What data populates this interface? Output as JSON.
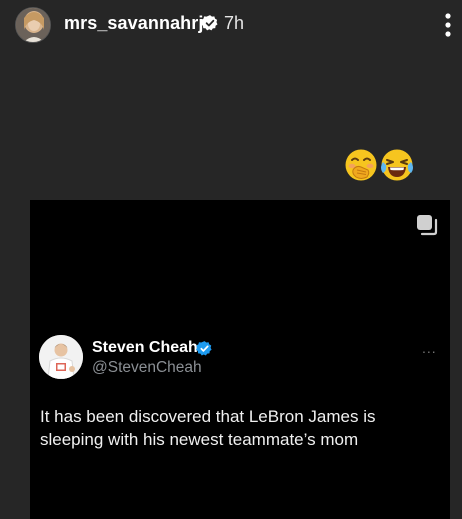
{
  "story": {
    "username": "mrs_savannahrj",
    "time": "7h",
    "emojis": [
      "face-with-hand-over-mouth",
      "face-with-tears-of-joy"
    ]
  },
  "tweet": {
    "name": "Steven Cheah",
    "handle": "@StevenCheah",
    "more": "...",
    "text": "It has been discovered that LeBron James is sleeping with his newest teammate’s mom"
  },
  "colors": {
    "background": "#262626",
    "card": "#000000",
    "verified": "#1d9bf0",
    "handle": "#8b8f94"
  }
}
